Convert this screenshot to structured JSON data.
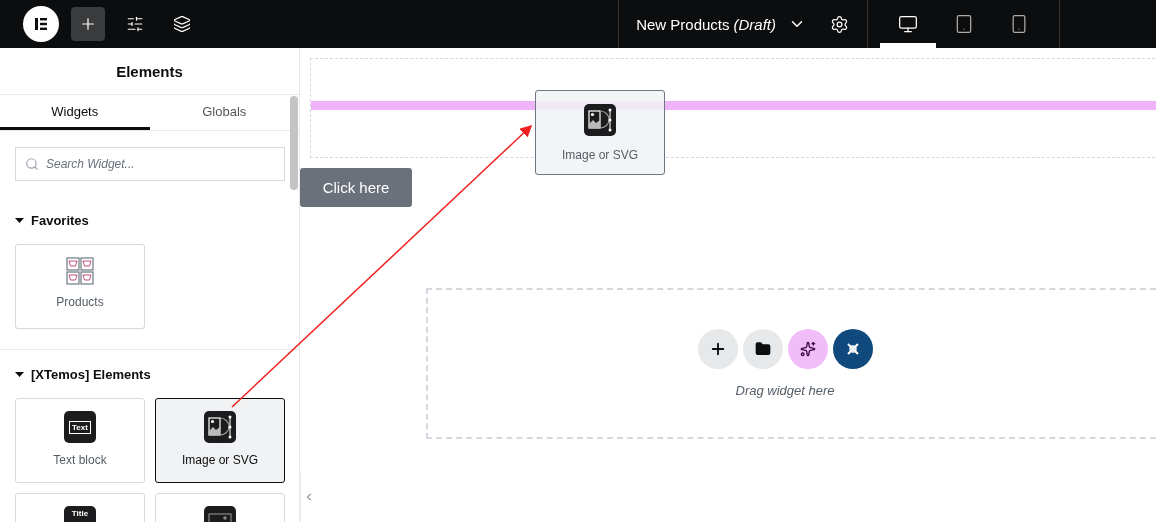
{
  "toolbar": {
    "logo": {
      "kind": "elementor"
    },
    "buttons": [
      {
        "kind": "add",
        "selected": true
      },
      {
        "kind": "settings",
        "selected": false
      },
      {
        "kind": "layers",
        "selected": false
      }
    ],
    "document": {
      "title": "New Products",
      "status": "(Draft)"
    },
    "devices": [
      {
        "kind": "desktop",
        "selected": true
      },
      {
        "kind": "tablet",
        "selected": false
      },
      {
        "kind": "mobile",
        "selected": false
      }
    ]
  },
  "panel": {
    "title": "Elements",
    "tabs": [
      {
        "label": "Widgets",
        "selected": true
      },
      {
        "label": "Globals",
        "selected": false
      }
    ],
    "search": {
      "placeholder": "Search Widget..."
    },
    "categories": [
      {
        "title": "Favorites",
        "expanded": true,
        "widgets": [
          {
            "label": "Products",
            "kind": "products",
            "selected": false
          }
        ]
      },
      {
        "title": "[XTemos] Elements",
        "expanded": true,
        "widgets": [
          {
            "label": "Text block",
            "kind": "text",
            "icon_text": "Text",
            "selected": false
          },
          {
            "label": "Image or SVG",
            "kind": "image",
            "selected": true
          },
          {
            "kind": "title",
            "icon_text": "Title",
            "selected": false
          },
          {
            "kind": "banner",
            "selected": false
          }
        ]
      }
    ]
  },
  "canvas": {
    "drag_ghost": {
      "label": "Image or SVG"
    },
    "button": {
      "label": "Click here"
    },
    "drop_zone": {
      "hint": "Drag widget here",
      "actions": [
        {
          "kind": "add"
        },
        {
          "kind": "template"
        },
        {
          "kind": "ai"
        },
        {
          "kind": "kit"
        }
      ]
    }
  }
}
